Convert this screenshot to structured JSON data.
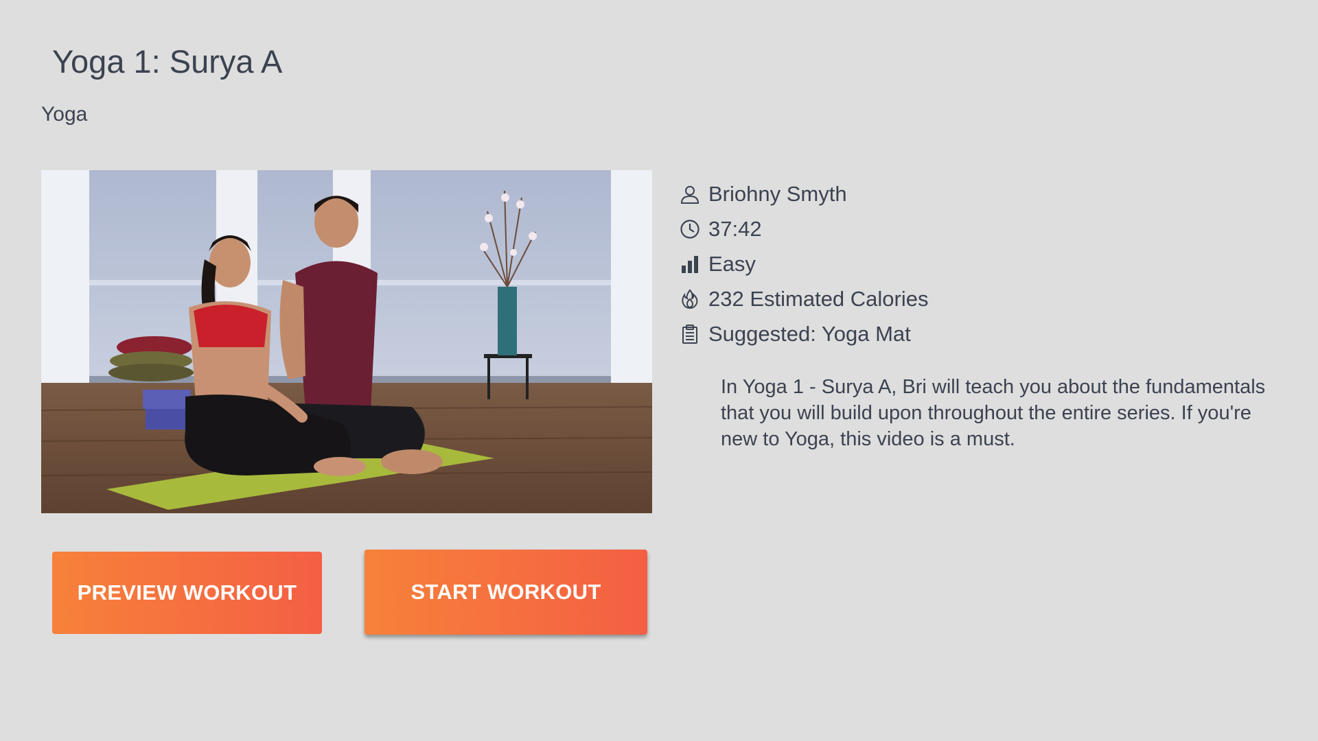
{
  "header": {
    "title": "Yoga 1: Surya A",
    "category": "Yoga"
  },
  "details": [
    {
      "icon": "person-icon",
      "text": "Briohny Smyth"
    },
    {
      "icon": "clock-icon",
      "text": "37:42"
    },
    {
      "icon": "difficulty-bars-icon",
      "text": "Easy"
    },
    {
      "icon": "flame-icon",
      "text": "232 Estimated Calories"
    },
    {
      "icon": "clipboard-icon",
      "text": "Suggested: Yoga Mat"
    }
  ],
  "description": "In Yoga 1 - Surya A, Bri will teach you about the fundamentals that you will build upon throughout the entire series.  If you're new to Yoga, this video is a must.",
  "actions": {
    "preview_label": "PREVIEW WORKOUT",
    "start_label": "START WORKOUT"
  },
  "colors": {
    "background": "#dedede",
    "text": "#3b4250",
    "button_gradient_start": "#f7813a",
    "button_gradient_end": "#f45f44"
  }
}
